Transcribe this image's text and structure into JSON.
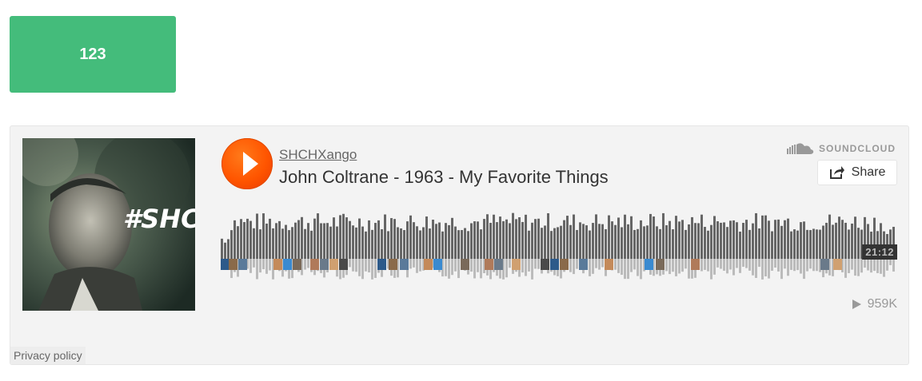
{
  "top_button": {
    "label": "123",
    "color": "#44bc7b"
  },
  "player": {
    "artist": "SHCHXango",
    "title": "John Coltrane - 1963 - My Favorite Things",
    "brand": "SOUNDCLOUD",
    "share_label": "Share",
    "duration": "21:12",
    "play_count": "959K",
    "artwork_text": "#SHCHX",
    "accent_color": "#ff5500",
    "icons": {
      "play": "play-icon",
      "cloud": "soundcloud-logo-icon",
      "share": "share-icon",
      "plays": "play-count-icon"
    }
  },
  "footer": {
    "privacy_label": "Privacy policy"
  }
}
